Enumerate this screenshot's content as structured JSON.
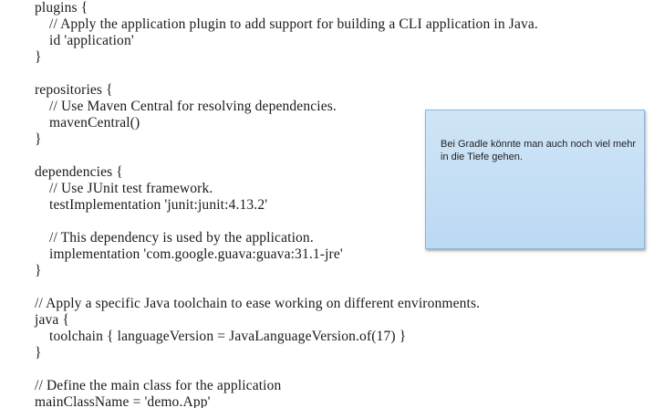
{
  "code_lines": [
    "plugins {",
    "// Apply the application plugin to add support for building a CLI application in Java.",
    "id 'application'",
    "}",
    "repositories {",
    "// Use Maven Central for resolving dependencies.",
    "mavenCentral()",
    "}",
    "dependencies {",
    "// Use JUnit test framework.",
    "testImplementation 'junit:junit:4.13.2'",
    "// This dependency is used by the application.",
    "implementation 'com.google.guava:guava:31.1-jre'",
    "}",
    "// Apply a specific Java toolchain to ease working on different environments.",
    "java {",
    "toolchain { languageVersion = JavaLanguageVersion.of(17) }",
    "}",
    "// Define the main class for the application",
    "mainClassName = 'demo.App'"
  ],
  "note": {
    "text": "Bei Gradle könnte man auch noch viel mehr in die Tiefe gehen."
  }
}
